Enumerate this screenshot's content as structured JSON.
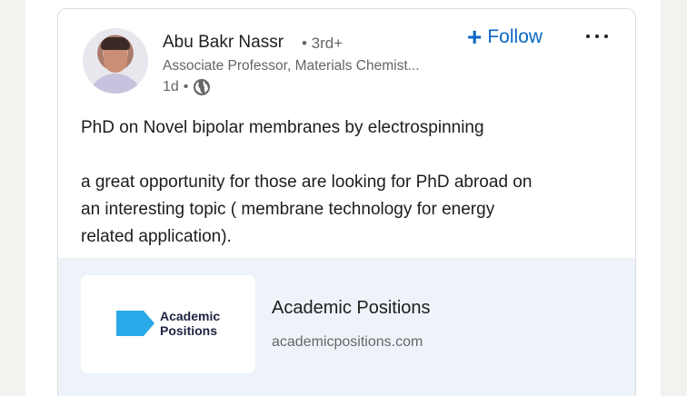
{
  "post": {
    "author": {
      "name": "Abu Bakr Nassr",
      "degree": "• 3rd+",
      "headline": "Associate Professor, Materials Chemist...",
      "time": "1d",
      "separator": "•",
      "visibility_icon": "globe-icon"
    },
    "follow_label": "Follow",
    "follow_icon": "+",
    "more_icon": "ellipsis-icon",
    "body": {
      "line1": "PhD on Novel bipolar membranes by electrospinning",
      "line2": "a great opportunity for those are looking for PhD abroad on",
      "line3": "an interesting topic ( membrane technology for energy",
      "line4": "related application)."
    },
    "link_preview": {
      "logo_line1": "Academic",
      "logo_line2": "Positions",
      "title": "Academic Positions",
      "domain": "academicpositions.com"
    }
  },
  "colors": {
    "accent": "#0a66c2",
    "logo_blue": "#2aa9e8",
    "preview_bg": "#edf3f8",
    "page_bg": "#f4f2ee"
  }
}
